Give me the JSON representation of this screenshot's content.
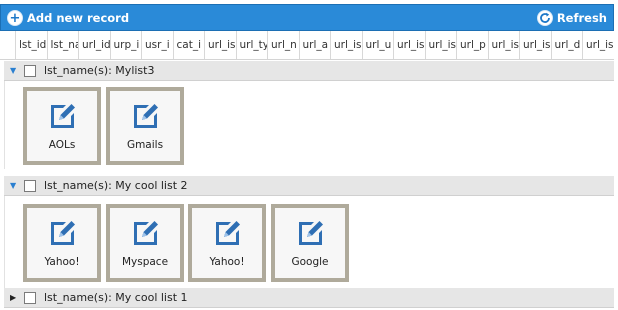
{
  "toolbar": {
    "add_label": "Add new record",
    "refresh_label": "Refresh"
  },
  "columns": [
    "lst_id",
    "lst_na",
    "url_id",
    "urp_i",
    "usr_i",
    "cat_i",
    "url_is",
    "url_ty",
    "url_n",
    "url_a",
    "url_is",
    "url_u",
    "url_is",
    "url_is",
    "url_p",
    "url_is",
    "url_is",
    "url_d",
    "url_is"
  ],
  "groups": [
    {
      "label": "lst_name(s): Mylist3",
      "expanded": true,
      "items": [
        "AOLs",
        "Gmails"
      ]
    },
    {
      "label": "lst_name(s): My cool list 2",
      "expanded": true,
      "items": [
        "Yahoo!",
        "Myspace",
        "Yahoo!",
        "Google"
      ]
    },
    {
      "label": "lst_name(s): My cool list 1",
      "expanded": false,
      "items": []
    }
  ],
  "icons": {
    "add": "plus-circle-icon",
    "refresh": "refresh-icon",
    "tile": "edit-document-icon",
    "expanded": "triangle-down-icon",
    "collapsed": "triangle-right-icon"
  },
  "colors": {
    "toolbar": "#2a8ad8",
    "tile_border": "#afaa9b",
    "group_bg": "#e6e6e6",
    "icon_blue": "#2f6fb4"
  }
}
